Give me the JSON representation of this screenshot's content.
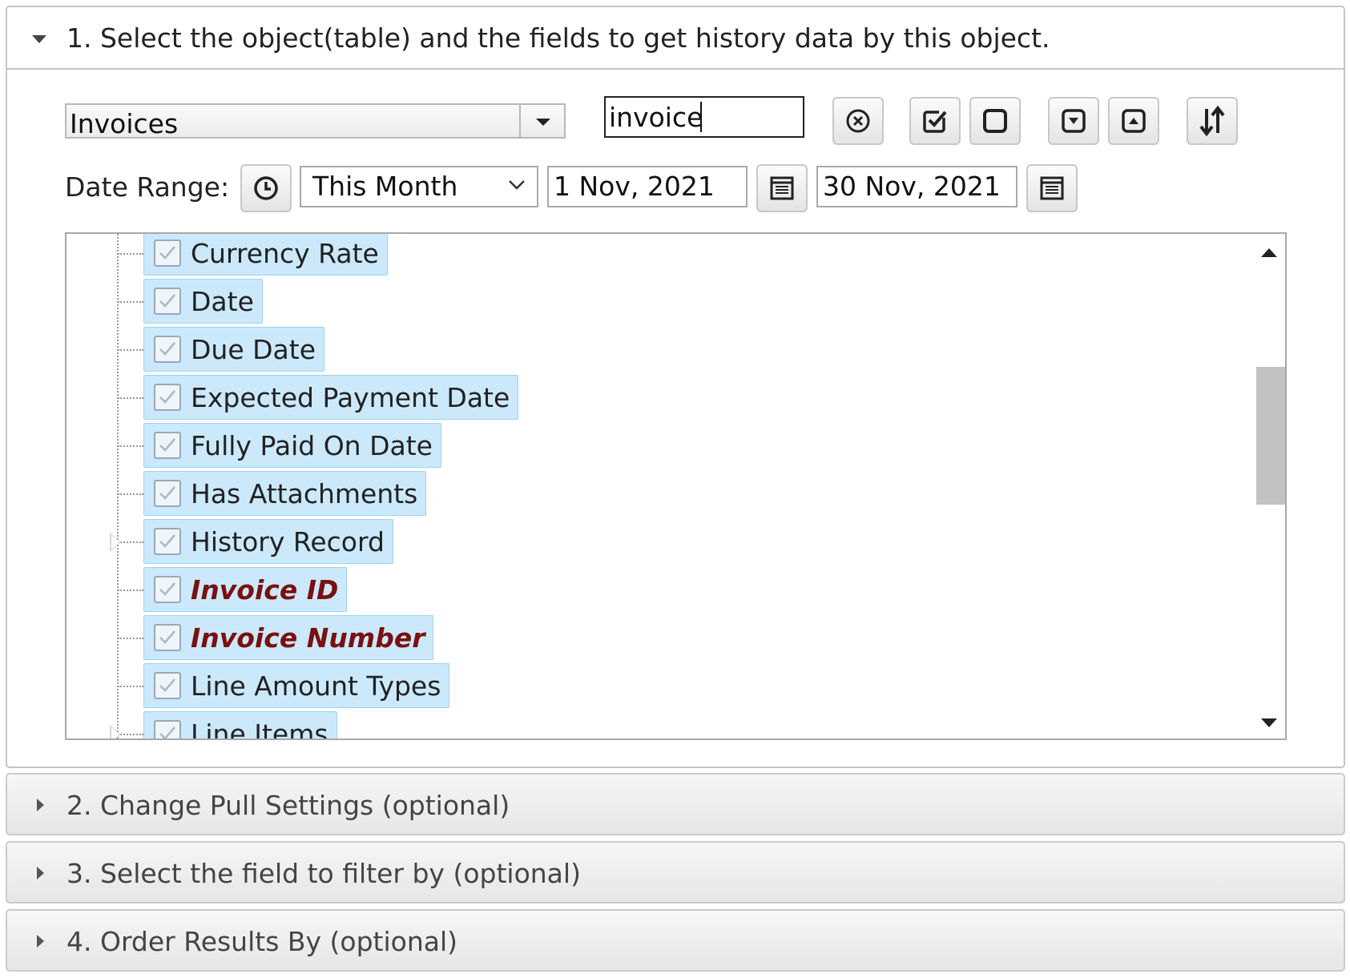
{
  "sections": {
    "s1": "1. Select the object(table) and the fields to get history data by this object.",
    "s2": "2. Change Pull Settings (optional)",
    "s3": "3. Select the field to filter by (optional)",
    "s4": "4. Order Results By (optional)"
  },
  "object_select": {
    "value": "Invoices"
  },
  "search": {
    "value": "invoice"
  },
  "toolbar": {
    "icons": [
      "clear-search-icon",
      "check-all-icon",
      "uncheck-all-icon",
      "expand-all-icon",
      "collapse-all-icon",
      "sort-icon"
    ]
  },
  "date_range": {
    "label": "Date Range:",
    "preset": "This Month",
    "start": "1 Nov, 2021",
    "end": "30 Nov, 2021"
  },
  "tree": {
    "items": [
      {
        "label": "Currency Rate",
        "checked": true,
        "highlight": false
      },
      {
        "label": "Date",
        "checked": true,
        "highlight": false
      },
      {
        "label": "Due Date",
        "checked": true,
        "highlight": false
      },
      {
        "label": "Expected Payment Date",
        "checked": true,
        "highlight": false
      },
      {
        "label": "Fully Paid On Date",
        "checked": true,
        "highlight": false
      },
      {
        "label": "Has Attachments",
        "checked": true,
        "highlight": false
      },
      {
        "label": "History Record",
        "checked": true,
        "highlight": false,
        "expandable": true
      },
      {
        "label": "Invoice ID",
        "checked": true,
        "highlight": true
      },
      {
        "label": "Invoice Number",
        "checked": true,
        "highlight": true
      },
      {
        "label": "Line Amount Types",
        "checked": true,
        "highlight": false
      },
      {
        "label": "Line Items",
        "checked": true,
        "highlight": false,
        "expandable": true
      }
    ]
  },
  "colors": {
    "chip_bg": "#cbe9fb",
    "highlight_text": "#7a1010"
  }
}
